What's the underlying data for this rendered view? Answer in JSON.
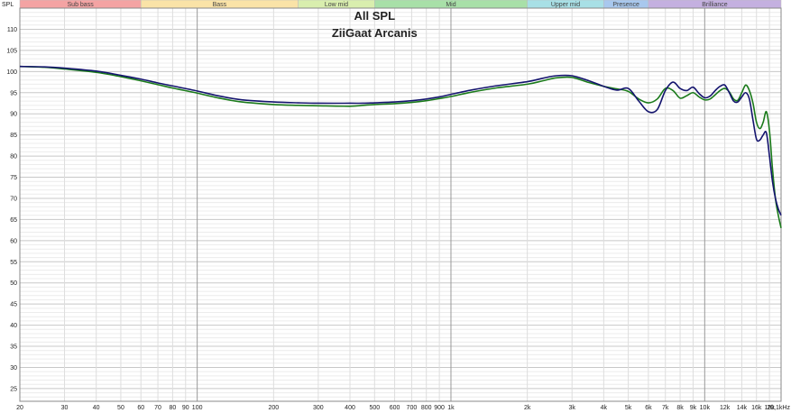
{
  "chart_data": {
    "type": "line",
    "title": "All SPL",
    "subtitle": "ZiiGaat Arcanis",
    "ylabel": "SPL",
    "xlabel_unit": "kHz",
    "x_scale": "log",
    "xlim": [
      20,
      20000
    ],
    "ylim": [
      22,
      115
    ],
    "grid": true,
    "bands": [
      {
        "label": "Sub bass",
        "from": 20,
        "to": 60,
        "color": "#f4a3a3"
      },
      {
        "label": "Bass",
        "from": 60,
        "to": 250,
        "color": "#fae3a7"
      },
      {
        "label": "Low mid",
        "from": 250,
        "to": 500,
        "color": "#d9eeae"
      },
      {
        "label": "Mid",
        "from": 500,
        "to": 2000,
        "color": "#a8e0a8"
      },
      {
        "label": "Upper mid",
        "from": 2000,
        "to": 4000,
        "color": "#a8e0e6"
      },
      {
        "label": "Presence",
        "from": 4000,
        "to": 6000,
        "color": "#a8c8ee"
      },
      {
        "label": "Brilliance",
        "from": 6000,
        "to": 20000,
        "color": "#c4b0e0"
      }
    ],
    "y_ticks": [
      25,
      30,
      35,
      40,
      45,
      50,
      55,
      60,
      65,
      70,
      75,
      80,
      85,
      90,
      95,
      100,
      105,
      110
    ],
    "x_ticks": [
      {
        "value": 20,
        "label": "20"
      },
      {
        "value": 30,
        "label": "30"
      },
      {
        "value": 40,
        "label": "40"
      },
      {
        "value": 50,
        "label": "50"
      },
      {
        "value": 60,
        "label": "60"
      },
      {
        "value": 70,
        "label": "70"
      },
      {
        "value": 80,
        "label": "80"
      },
      {
        "value": 90,
        "label": "90"
      },
      {
        "value": 100,
        "label": "100"
      },
      {
        "value": 200,
        "label": "200"
      },
      {
        "value": 300,
        "label": "300"
      },
      {
        "value": 400,
        "label": "400"
      },
      {
        "value": 500,
        "label": "500"
      },
      {
        "value": 600,
        "label": "600"
      },
      {
        "value": 700,
        "label": "700"
      },
      {
        "value": 800,
        "label": "800"
      },
      {
        "value": 900,
        "label": "900"
      },
      {
        "value": 1000,
        "label": "1k"
      },
      {
        "value": 2000,
        "label": "2k"
      },
      {
        "value": 3000,
        "label": "3k"
      },
      {
        "value": 4000,
        "label": "4k"
      },
      {
        "value": 5000,
        "label": "5k"
      },
      {
        "value": 6000,
        "label": "6k"
      },
      {
        "value": 7000,
        "label": "7k"
      },
      {
        "value": 8000,
        "label": "8k"
      },
      {
        "value": 9000,
        "label": "9k"
      },
      {
        "value": 10000,
        "label": "10k"
      },
      {
        "value": 12000,
        "label": "12k"
      },
      {
        "value": 14000,
        "label": "14k"
      },
      {
        "value": 16000,
        "label": "16k"
      },
      {
        "value": 18000,
        "label": "18k"
      },
      {
        "value": 20000,
        "label": "20,1kHz"
      }
    ],
    "series": [
      {
        "color": "#1a7a1a",
        "x": [
          20,
          25,
          30,
          40,
          50,
          60,
          70,
          80,
          100,
          120,
          150,
          200,
          250,
          300,
          400,
          450,
          500,
          600,
          700,
          800,
          900,
          1000,
          1200,
          1500,
          2000,
          2300,
          2600,
          3000,
          3500,
          4000,
          4500,
          5000,
          5500,
          6000,
          6500,
          7000,
          7500,
          8000,
          8500,
          9000,
          9500,
          10000,
          10500,
          11000,
          11500,
          12000,
          12500,
          13000,
          13500,
          14000,
          14500,
          15000,
          15500,
          16000,
          16500,
          17000,
          17500,
          18000,
          18500,
          19000,
          19500,
          20000
        ],
        "y": [
          101.2,
          101.0,
          100.6,
          99.8,
          98.8,
          97.8,
          96.9,
          96.1,
          94.9,
          93.8,
          92.8,
          92.2,
          92.0,
          91.9,
          91.8,
          92.0,
          92.2,
          92.4,
          92.7,
          93.1,
          93.6,
          94.1,
          95.1,
          96.1,
          97.0,
          97.8,
          98.5,
          98.6,
          97.4,
          96.5,
          95.9,
          95.3,
          93.5,
          92.6,
          93.5,
          96.0,
          95.5,
          93.7,
          94.3,
          95.0,
          94.0,
          93.3,
          93.5,
          94.5,
          95.5,
          96.0,
          95.2,
          93.5,
          93.2,
          95.0,
          96.8,
          95.5,
          92.5,
          88.0,
          86.5,
          88.0,
          90.5,
          86.0,
          77.0,
          70.0,
          66.0,
          63.0
        ]
      },
      {
        "color": "#14146e",
        "x": [
          20,
          25,
          30,
          40,
          50,
          60,
          70,
          80,
          100,
          120,
          150,
          200,
          250,
          300,
          400,
          450,
          500,
          600,
          700,
          800,
          900,
          1000,
          1200,
          1500,
          2000,
          2300,
          2600,
          3000,
          3500,
          4000,
          4500,
          5000,
          5500,
          6000,
          6500,
          7000,
          7500,
          8000,
          8500,
          9000,
          9500,
          10000,
          10500,
          11000,
          11500,
          12000,
          12500,
          13000,
          13500,
          14000,
          14500,
          15000,
          15500,
          16000,
          16500,
          17000,
          17500,
          18000,
          18500,
          19000,
          19500,
          20000
        ],
        "y": [
          101.2,
          101.1,
          100.8,
          100.1,
          99.1,
          98.2,
          97.3,
          96.6,
          95.4,
          94.3,
          93.3,
          92.8,
          92.6,
          92.5,
          92.5,
          92.5,
          92.6,
          92.8,
          93.1,
          93.5,
          94.0,
          94.6,
          95.6,
          96.6,
          97.6,
          98.4,
          99.0,
          99.0,
          97.8,
          96.5,
          95.6,
          96.0,
          93.0,
          90.5,
          91.0,
          95.5,
          97.5,
          96.0,
          95.5,
          96.3,
          94.8,
          93.8,
          94.2,
          95.5,
          96.5,
          96.8,
          95.0,
          93.0,
          92.8,
          94.0,
          95.0,
          93.5,
          88.5,
          84.0,
          83.8,
          85.0,
          85.5,
          80.0,
          74.0,
          70.0,
          67.5,
          66.0
        ]
      }
    ]
  }
}
